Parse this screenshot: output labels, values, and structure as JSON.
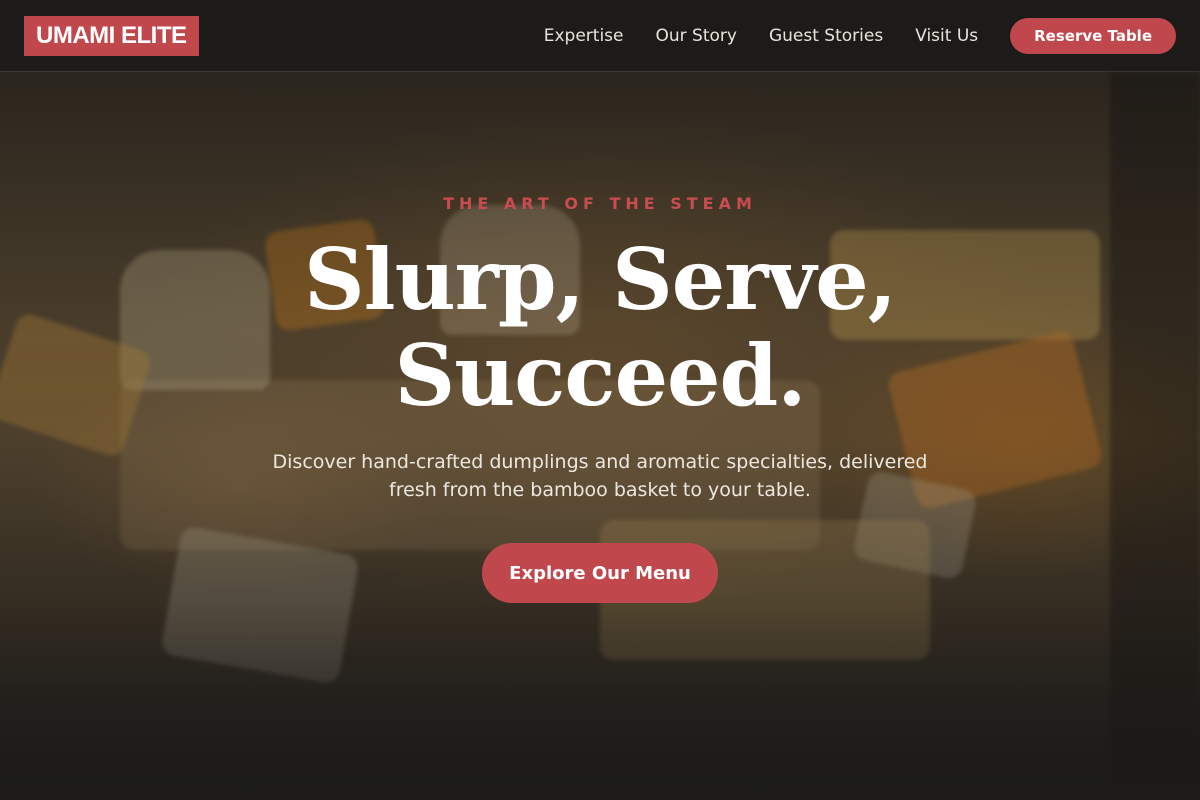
{
  "header": {
    "logo": "UMAMI ELITE",
    "nav": [
      "Expertise",
      "Our Story",
      "Guest Stories",
      "Visit Us"
    ],
    "reserve_label": "Reserve Table"
  },
  "hero": {
    "eyebrow": "THE ART OF THE STEAM",
    "title_line1": "Slurp, Serve,",
    "title_line2": "Succeed.",
    "subtitle": "Discover hand-crafted dumplings and aromatic specialties, delivered fresh from the bamboo basket to your table.",
    "cta_label": "Explore Our Menu"
  },
  "colors": {
    "accent": "#c0484d",
    "header_bg": "#1c1b1a",
    "text_light": "#ffffff"
  }
}
